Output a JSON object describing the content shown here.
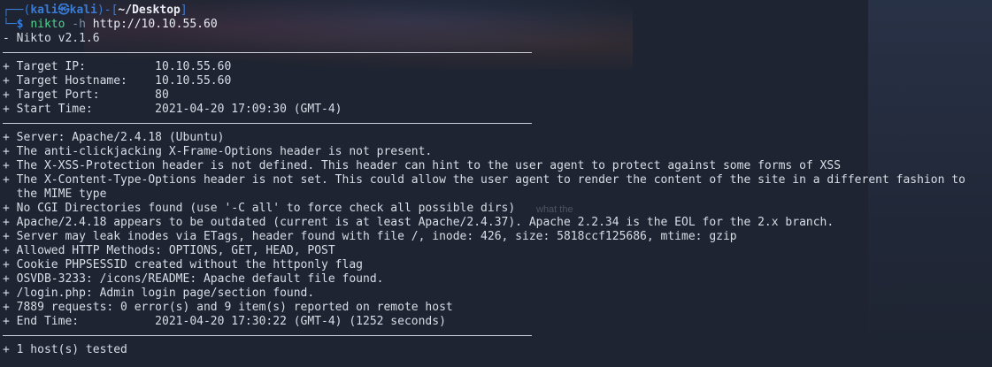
{
  "prompt": {
    "corner_top": "┌──(",
    "user_host": "kali㉿kali",
    "mid": ")-[",
    "path": "~/Desktop",
    "end": "]",
    "corner_bottom": "└─",
    "dollar": "$",
    "command": "nikto",
    "flag": "-h",
    "argument": "http://10.10.55.60"
  },
  "output": {
    "version": "- Nikto v2.1.6",
    "target_info": [
      "+ Target IP:          10.10.55.60",
      "+ Target Hostname:    10.10.55.60",
      "+ Target Port:        80",
      "+ Start Time:         2021-04-20 17:09:30 (GMT-4)"
    ],
    "findings": [
      "+ Server: Apache/2.4.18 (Ubuntu)",
      "+ The anti-clickjacking X-Frame-Options header is not present.",
      "+ The X-XSS-Protection header is not defined. This header can hint to the user agent to protect against some forms of XSS",
      "+ The X-Content-Type-Options header is not set. This could allow the user agent to render the content of the site in a different fashion to",
      "  the MIME type",
      "+ No CGI Directories found (use '-C all' to force check all possible dirs)",
      "+ Apache/2.4.18 appears to be outdated (current is at least Apache/2.4.37). Apache 2.2.34 is the EOL for the 2.x branch.",
      "+ Server may leak inodes via ETags, header found with file /, inode: 426, size: 5818ccf125686, mtime: gzip",
      "+ Allowed HTTP Methods: OPTIONS, GET, HEAD, POST",
      "+ Cookie PHPSESSID created without the httponly flag",
      "+ OSVDB-3233: /icons/README: Apache default file found.",
      "+ /login.php: Admin login page/section found.",
      "+ 7889 requests: 0 error(s) and 9 item(s) reported on remote host",
      "+ End Time:           2021-04-20 17:30:22 (GMT-4) (1252 seconds)"
    ],
    "summary": "+ 1 host(s) tested"
  },
  "background_text": "what the",
  "colors": {
    "background": "#1e2431",
    "prompt": "#3a7bd5",
    "command": "#4fd38d",
    "text": "#d8dde6"
  }
}
